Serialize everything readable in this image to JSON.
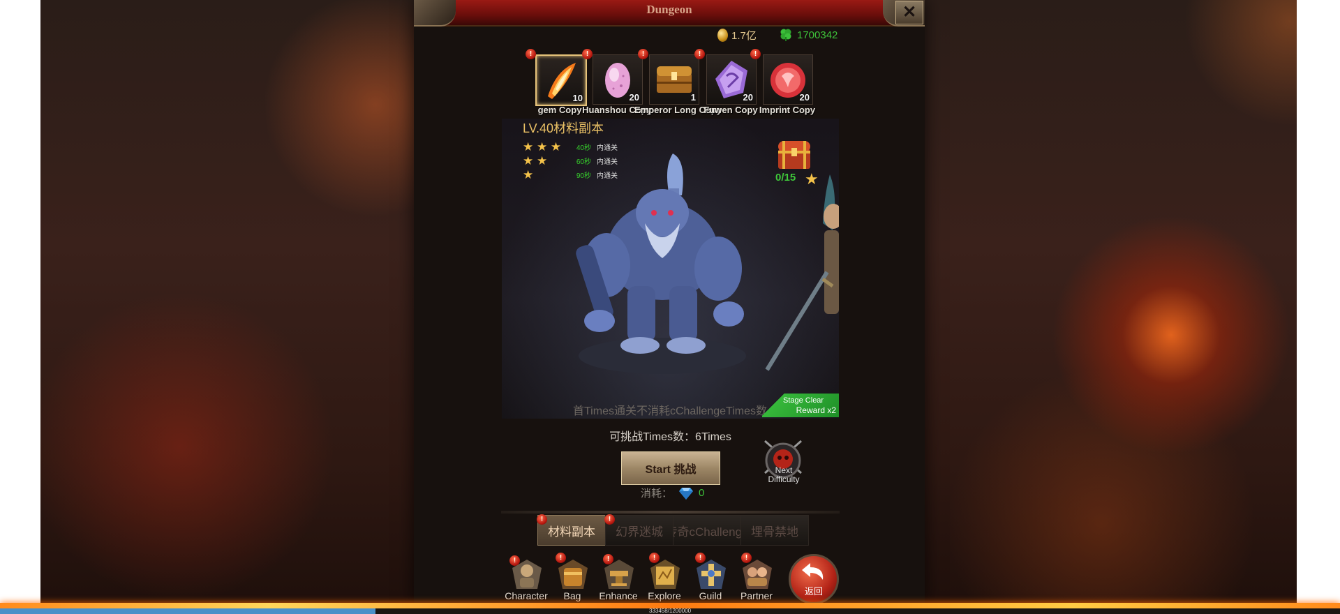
{
  "window": {
    "title": "Dungeon"
  },
  "currency": {
    "gold": "1.7亿",
    "clover": "1700342"
  },
  "material_tabs": [
    {
      "label": "gem Copy",
      "count": "10",
      "active": true
    },
    {
      "label": "Huanshou Copy",
      "count": "20",
      "active": false
    },
    {
      "label": "Emperor Long Copy",
      "count": "1",
      "active": false
    },
    {
      "label": "Fuwen Copy",
      "count": "20",
      "active": false
    },
    {
      "label": "Imprint Copy",
      "count": "20",
      "active": false
    }
  ],
  "stage": {
    "title": "LV.40材料副本",
    "star_requirements": [
      {
        "stars": "★ ★ ★",
        "time": "40秒",
        "desc": "内通关"
      },
      {
        "stars": "★ ★",
        "time": "60秒",
        "desc": "内通关"
      },
      {
        "stars": "★",
        "time": "90秒",
        "desc": "内通关"
      }
    ],
    "chest_progress": "0/15",
    "first_clear_note": "首Times通关不消耗cChallengeTimes数",
    "reward_badge": {
      "line1": "Stage Clear",
      "line2": "Reward x2"
    }
  },
  "challenge": {
    "times_text": "可挑战Times数：6Times",
    "start_label": "Start 挑战",
    "cost_label": "消耗：",
    "cost_value": "0",
    "next_difficulty": "Next Difficulty"
  },
  "sub_tabs": [
    {
      "label": "材料副本",
      "active": true
    },
    {
      "label": "幻界迷城",
      "active": false
    },
    {
      "label": "传奇cChallenge",
      "active": false
    },
    {
      "label": "埋骨禁地",
      "active": false
    }
  ],
  "bottom_nav": [
    {
      "label": "Character"
    },
    {
      "label": "Bag"
    },
    {
      "label": "Enhance"
    },
    {
      "label": "Explore"
    },
    {
      "label": "Guild"
    },
    {
      "label": "Partner"
    }
  ],
  "return_label": "返回",
  "exp": {
    "text": "333458/1200000",
    "fraction": 0.28
  },
  "colors": {
    "accent_gold": "#e9c065",
    "success_green": "#3ec33a",
    "title_red": "#9a1a14"
  }
}
